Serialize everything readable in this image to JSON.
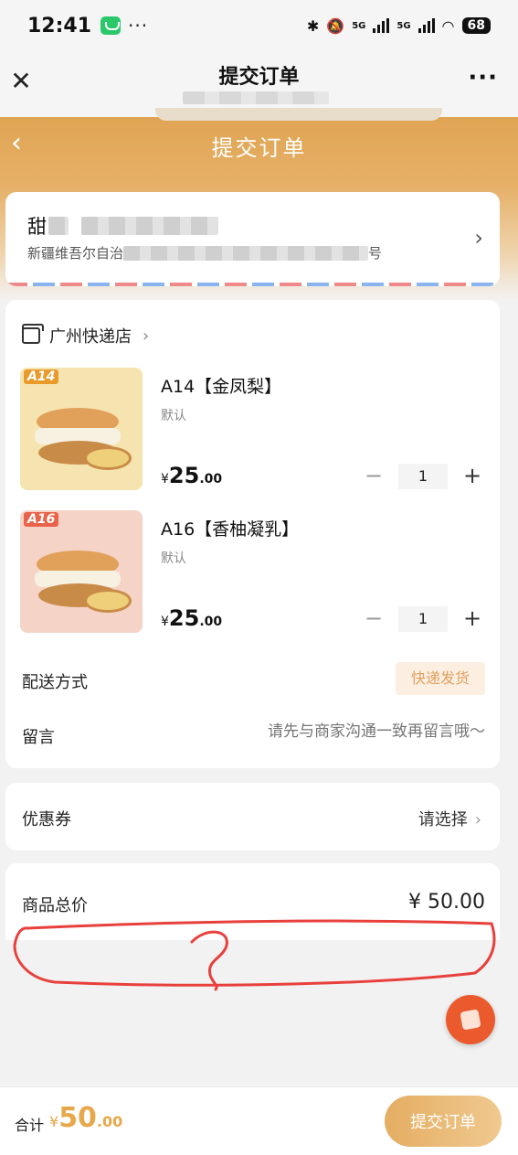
{
  "status_bar": {
    "time": "12:41",
    "dots": "···",
    "net1": "5G",
    "net2": "5G",
    "battery": "68"
  },
  "top_nav": {
    "title": "提交订单",
    "more": "···"
  },
  "header": {
    "title": "提交订单"
  },
  "address": {
    "name_prefix": "甜",
    "line_prefix": "新疆维吾尔自治",
    "line_suffix": "号"
  },
  "store": {
    "name": "广州快递店"
  },
  "products": [
    {
      "tag": "A14",
      "name": "A14【金凤梨】",
      "spec": "默认",
      "currency": "¥",
      "price_int": "25",
      "price_dec": ".00",
      "qty": "1"
    },
    {
      "tag": "A16",
      "name": "A16【香柚凝乳】",
      "spec": "默认",
      "currency": "¥",
      "price_int": "25",
      "price_dec": ".00",
      "qty": "1"
    }
  ],
  "shipping": {
    "label": "配送方式",
    "value": "快递发货"
  },
  "message": {
    "label": "留言",
    "placeholder": "请先与商家沟通一致再留言哦～"
  },
  "coupon": {
    "label": "优惠券",
    "value": "请选择"
  },
  "total": {
    "label": "商品总价",
    "value": "¥ 50.00"
  },
  "bottom": {
    "sum_label": "合计",
    "currency": "¥",
    "sum_int": "50",
    "sum_dec": ".00",
    "submit": "提交订单"
  },
  "colors": {
    "accent": "#e0a553",
    "scribble": "#e8403c",
    "float_button": "#ea5a2c"
  }
}
